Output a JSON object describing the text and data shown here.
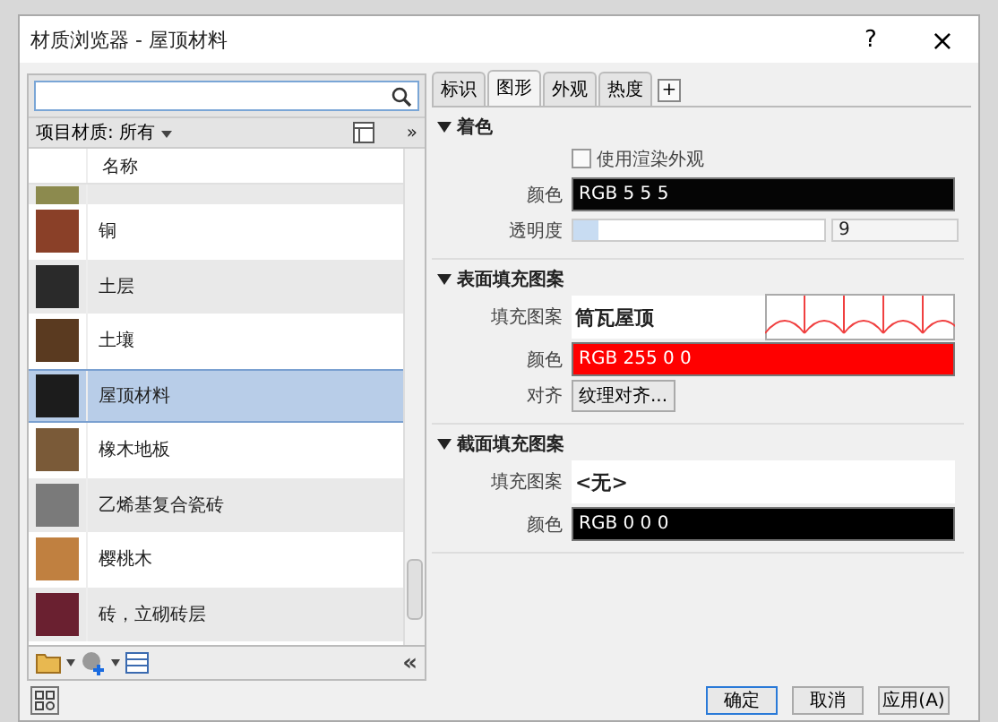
{
  "window": {
    "title": "材质浏览器 - 屋顶材料",
    "help": "?",
    "close": "×"
  },
  "browser": {
    "filter": "项目材质: 所有",
    "more": "»",
    "column": "名称",
    "materials": [
      {
        "color": "#8c8a4e",
        "selected": false
      },
      {
        "name": "铜",
        "color": "#8a4028",
        "selected": false
      },
      {
        "name": "土层",
        "color": "#2a2a2a",
        "selected": false
      },
      {
        "name": "土壤",
        "color": "#5a3a20",
        "selected": false
      },
      {
        "name": "屋顶材料",
        "color": "#1c1c1c",
        "selected": true
      },
      {
        "name": "橡木地板",
        "color": "#7a5a38",
        "selected": false
      },
      {
        "name": "乙烯基复合瓷砖",
        "color": "#7a7a7a",
        "selected": false
      },
      {
        "name": "樱桃木",
        "color": "#c08040",
        "selected": false
      },
      {
        "name": "砖，立砌砖层",
        "color": "#6a2030",
        "selected": false
      }
    ],
    "collapse": "«"
  },
  "tabs": [
    {
      "label": "标识",
      "selected": false
    },
    {
      "label": "图形",
      "selected": true
    },
    {
      "label": "外观",
      "selected": false
    },
    {
      "label": "热度",
      "selected": false
    }
  ],
  "add_tab": "+",
  "sections": [
    {
      "title": "着色",
      "expanded": true,
      "rows": [
        {
          "kind": "checkbox",
          "label": "使用渲染外观",
          "checked": false
        },
        {
          "kind": "color",
          "label": "颜色",
          "value": "RGB 5 5 5",
          "color": "#050505"
        },
        {
          "kind": "slider",
          "label": "透明度",
          "level": 0.1,
          "value": "9"
        }
      ]
    },
    {
      "title": "表面填充图案",
      "expanded": true,
      "rows": [
        {
          "kind": "pattern",
          "label": "填充图案",
          "value": "筒瓦屋顶",
          "preview": true
        },
        {
          "kind": "color",
          "label": "颜色",
          "value": "RGB 255 0 0",
          "color": "#ff0000"
        },
        {
          "kind": "button",
          "label": "对齐",
          "value": "纹理对齐..."
        }
      ]
    },
    {
      "title": "截面填充图案",
      "expanded": true,
      "rows": [
        {
          "kind": "pattern",
          "label": "填充图案",
          "value": "<无>",
          "preview": false
        },
        {
          "kind": "color",
          "label": "颜色",
          "value": "RGB 0 0 0",
          "color": "#000000"
        }
      ]
    }
  ],
  "buttons": [
    "确定",
    "取消",
    "应用(A)"
  ]
}
